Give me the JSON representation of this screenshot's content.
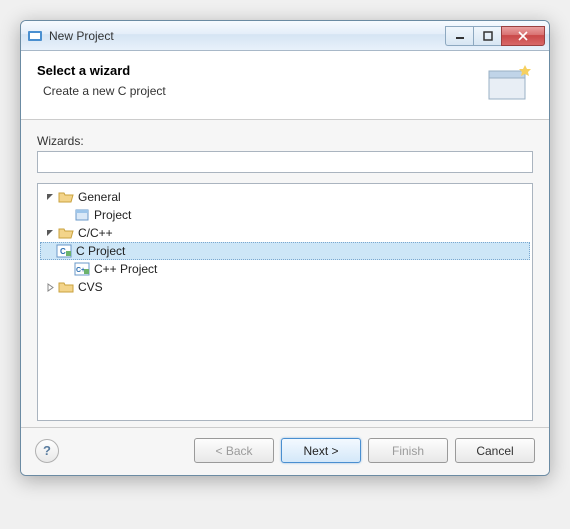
{
  "window": {
    "title": "New Project"
  },
  "header": {
    "title": "Select a wizard",
    "subtitle": "Create a new C project"
  },
  "wizards_label": "Wizards:",
  "filter_value": "",
  "tree": {
    "general": {
      "label": "General",
      "children": {
        "project": "Project"
      }
    },
    "ccpp": {
      "label": "C/C++",
      "children": {
        "cproject": "C Project",
        "cppproject": "C++ Project"
      }
    },
    "cvs": {
      "label": "CVS"
    }
  },
  "selected": "C Project",
  "buttons": {
    "back": "< Back",
    "next": "Next >",
    "finish": "Finish",
    "cancel": "Cancel"
  }
}
